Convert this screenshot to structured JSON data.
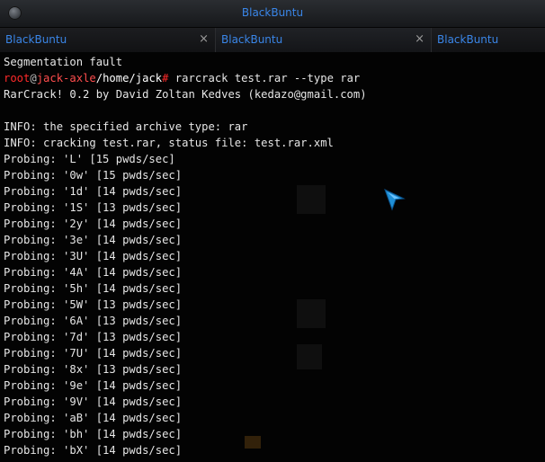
{
  "window": {
    "title": "BlackBuntu"
  },
  "tabs": [
    {
      "label": "BlackBuntu",
      "close": "×"
    },
    {
      "label": "BlackBuntu",
      "close": "×"
    },
    {
      "label": "BlackBuntu",
      "close": ""
    }
  ],
  "terminal": {
    "line_before_prompt": "Segmentation fault",
    "prompt": {
      "user": "root",
      "at": "@",
      "host": "jack-axle",
      "path": "/home/jack",
      "symbol": "#",
      "command": " rarcrack test.rar --type rar"
    },
    "output": [
      "RarCrack! 0.2 by David Zoltan Kedves (kedazo@gmail.com)",
      "",
      "INFO: the specified archive type: rar",
      "INFO: cracking test.rar, status file: test.rar.xml",
      "Probing: 'L' [15 pwds/sec]",
      "Probing: '0w' [15 pwds/sec]",
      "Probing: '1d' [14 pwds/sec]",
      "Probing: '1S' [13 pwds/sec]",
      "Probing: '2y' [14 pwds/sec]",
      "Probing: '3e' [14 pwds/sec]",
      "Probing: '3U' [14 pwds/sec]",
      "Probing: '4A' [14 pwds/sec]",
      "Probing: '5h' [14 pwds/sec]",
      "Probing: '5W' [13 pwds/sec]",
      "Probing: '6A' [13 pwds/sec]",
      "Probing: '7d' [13 pwds/sec]",
      "Probing: '7U' [14 pwds/sec]",
      "Probing: '8x' [13 pwds/sec]",
      "Probing: '9e' [14 pwds/sec]",
      "Probing: '9V' [14 pwds/sec]",
      "Probing: 'aB' [14 pwds/sec]",
      "Probing: 'bh' [14 pwds/sec]",
      "Probing: 'bX' [14 pwds/sec]"
    ]
  },
  "colors": {
    "title_blue": "#3a86e8",
    "prompt_red": "#ff2a2a",
    "terminal_bg": "#030303",
    "text": "#e6e6e6"
  },
  "icons": {
    "window_button": "circle-button-icon",
    "tab_close": "close-icon",
    "pointer": "mouse-pointer-icon"
  }
}
